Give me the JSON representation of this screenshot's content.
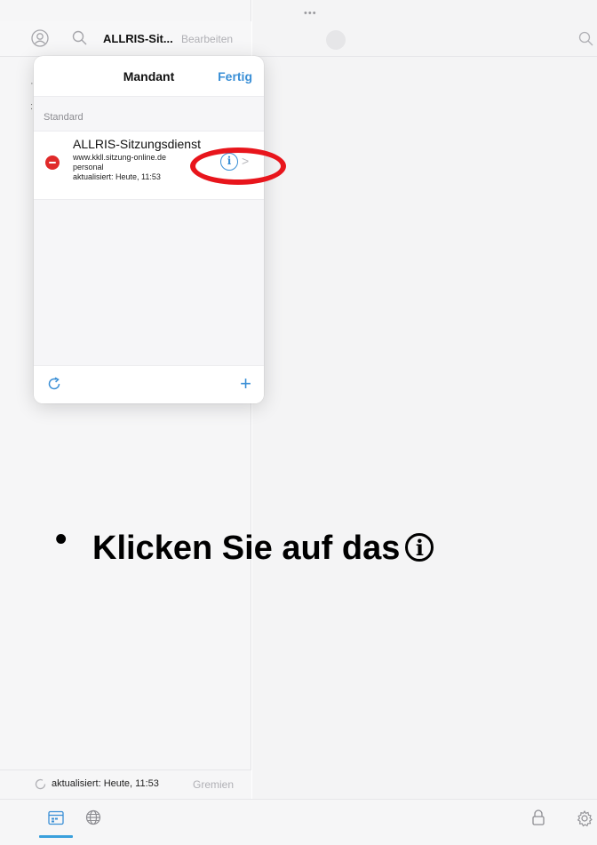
{
  "window": {
    "drag_handle": "•••"
  },
  "topbar": {
    "title": "ALLRIS-Sit...",
    "edit_label": "Bearbeiten"
  },
  "popover": {
    "title": "Mandant",
    "done_label": "Fertig",
    "section_label": "Standard",
    "entry": {
      "name": "ALLRIS-Sitzungsdienst",
      "url": "www.kkll.sitzung-online.de",
      "user": "personal",
      "updated": "aktualisiert: Heute, 11:53"
    },
    "info_glyph": "i",
    "chevron": ">",
    "add_glyph": "+"
  },
  "instruction": {
    "bullet": "•",
    "text": "Klicken Sie auf das",
    "icon_glyph": "i"
  },
  "status": {
    "updated": "aktualisiert: Heute, 11:53",
    "gremien_label": "Gremien"
  },
  "colors": {
    "accent": "#3a8fd6",
    "delete": "#e02a2a",
    "highlight": "#e8151c",
    "tab_indicator": "#3aa0dc"
  },
  "icons": [
    "profile-icon",
    "search-icon",
    "refresh-icon",
    "calendar-icon",
    "globe-icon",
    "lock-icon",
    "gear-icon"
  ]
}
